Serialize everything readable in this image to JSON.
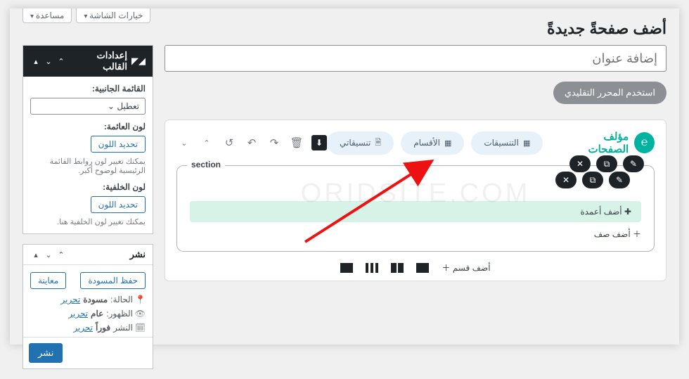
{
  "screenTabs": {
    "options": "خيارات الشاشة",
    "help": "مساعدة"
  },
  "pageTitle": "أضف صفحةً جديدةً",
  "titlePlaceholder": "إضافة عنوان",
  "classicEditorBtn": "استخدم المحرر التقليدي",
  "themeBox": {
    "title": "إعدادات القالب",
    "sideMenuLabel": "القائمة الجانبية:",
    "sideMenuValue": "تعطيل",
    "floatColorLabel": "لون العائمة:",
    "colorBtn": "تحديد اللون",
    "floatHint": "يمكنك تغيير لون روابط القائمة الرئيسية لوضوح أكبر.",
    "bgColorLabel": "لون الخلفية:",
    "bgHint": "يمكنك تغيير لون الخلفية هنا."
  },
  "publishBox": {
    "title": "نشر",
    "saveDraft": "حفظ المسودة",
    "preview": "معاينة",
    "statusLabel": "الحالة:",
    "statusValue": "مسودة",
    "visibilityLabel": "الظهور:",
    "visibilityValue": "عام",
    "scheduleLabel": "النشر",
    "scheduleValue": "فوراً",
    "edit": "تحرير",
    "publish": "نشر"
  },
  "builder": {
    "brand": "مؤلف الصفحات",
    "pillLayouts": "التنسيقات",
    "pillSections": "الأقسام",
    "pillMyLayouts": "تنسيقاتي",
    "sectionLegend": "section",
    "watermark": "ORIDSITE.COM",
    "addColumn": "✚  أضف أعمدة",
    "addRow": "＋  أضف صف",
    "addSection": "أضف قسم  ＋"
  }
}
